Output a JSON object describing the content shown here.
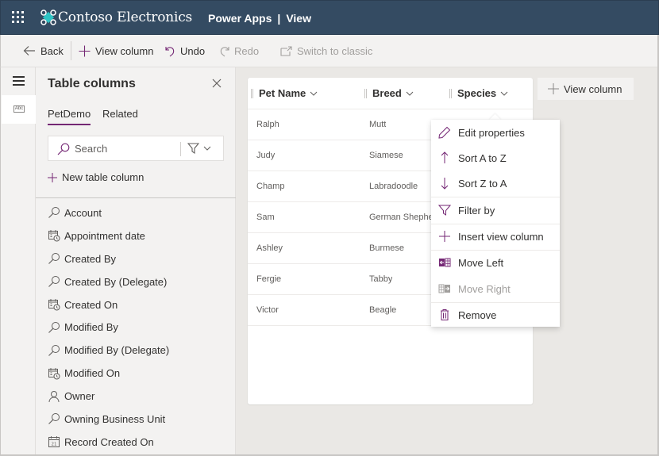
{
  "header": {
    "brand": "Contoso Electronics",
    "app_name": "Power Apps",
    "separator": "|",
    "page": "View",
    "colors": {
      "bar": "#344b62",
      "logo": "#2ec4c4"
    }
  },
  "commandbar": {
    "back": "Back",
    "view_column": "View column",
    "undo": "Undo",
    "redo": "Redo",
    "switch_classic": "Switch to classic"
  },
  "leftrail": {
    "menu_icon": "hamburger-icon",
    "active_icon_text": "Abc"
  },
  "panel": {
    "title": "Table columns",
    "tabs": [
      {
        "label": "PetDemo",
        "active": true
      },
      {
        "label": "Related",
        "active": false
      }
    ],
    "search_placeholder": "Search",
    "new_column": "New table column",
    "columns": [
      {
        "label": "Account",
        "icon": "lookup-icon"
      },
      {
        "label": "Appointment date",
        "icon": "datetime-icon"
      },
      {
        "label": "Created By",
        "icon": "lookup-icon"
      },
      {
        "label": "Created By (Delegate)",
        "icon": "lookup-icon"
      },
      {
        "label": "Created On",
        "icon": "datetime-icon"
      },
      {
        "label": "Modified By",
        "icon": "lookup-icon"
      },
      {
        "label": "Modified By (Delegate)",
        "icon": "lookup-icon"
      },
      {
        "label": "Modified On",
        "icon": "datetime-icon"
      },
      {
        "label": "Owner",
        "icon": "person-icon"
      },
      {
        "label": "Owning Business Unit",
        "icon": "lookup-icon"
      },
      {
        "label": "Record Created On",
        "icon": "calendar-icon"
      }
    ]
  },
  "grid": {
    "columns": [
      "Pet Name",
      "Breed",
      "Species"
    ],
    "rows": [
      [
        "Ralph",
        "Mutt",
        ""
      ],
      [
        "Judy",
        "Siamese",
        ""
      ],
      [
        "Champ",
        "Labradoodle",
        ""
      ],
      [
        "Sam",
        "German Shepherd",
        ""
      ],
      [
        "Ashley",
        "Burmese",
        ""
      ],
      [
        "Fergie",
        "Tabby",
        ""
      ],
      [
        "Victor",
        "Beagle",
        ""
      ]
    ],
    "add_column": "View column"
  },
  "context_menu": {
    "accent": "#742774",
    "items": [
      {
        "label": "Edit properties",
        "icon": "pencil-icon",
        "disabled": false
      },
      {
        "label": "Sort A to Z",
        "icon": "arrow-up-icon",
        "disabled": false
      },
      {
        "label": "Sort Z to A",
        "icon": "arrow-down-icon",
        "disabled": false
      },
      {
        "label": "Filter by",
        "icon": "filter-icon",
        "disabled": false
      },
      {
        "label": "Insert view column",
        "icon": "plus-icon",
        "disabled": false
      },
      {
        "label": "Move Left",
        "icon": "move-left-icon",
        "disabled": false
      },
      {
        "label": "Move Right",
        "icon": "move-right-icon",
        "disabled": true
      },
      {
        "label": "Remove",
        "icon": "trash-icon",
        "disabled": false
      }
    ]
  }
}
